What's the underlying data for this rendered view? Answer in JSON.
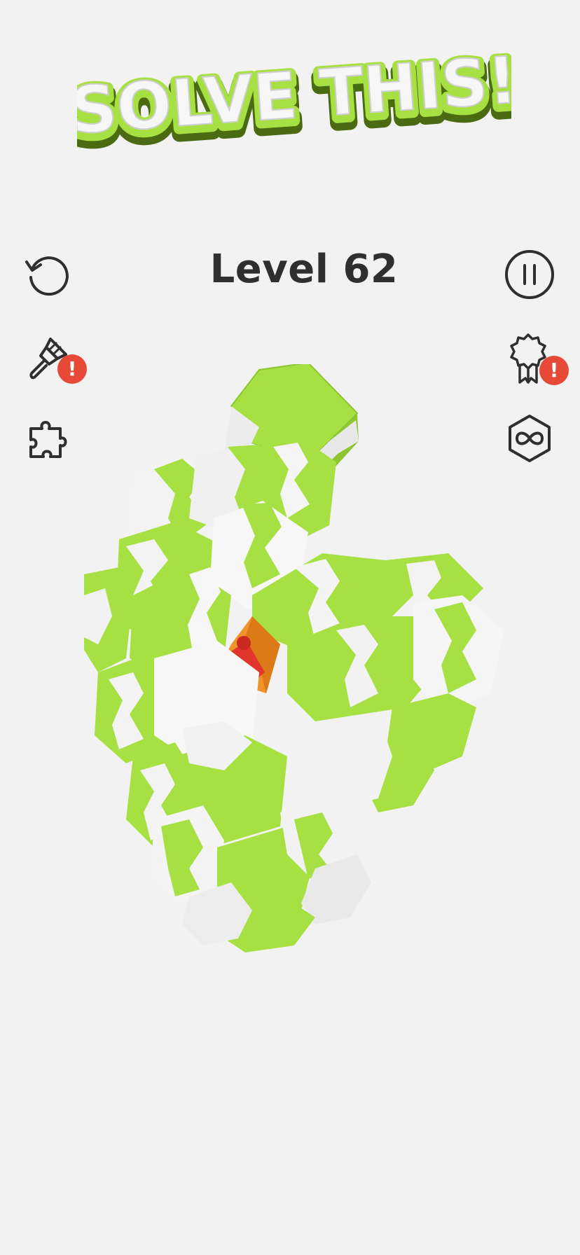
{
  "banner": {
    "text": "SOLVE THIS!"
  },
  "header": {
    "level_label": "Level 62"
  },
  "left_toolbar": {
    "restart": "restart-icon",
    "paint": "paint-brush-icon",
    "paint_badge": "!",
    "puzzle": "puzzle-piece-icon"
  },
  "right_toolbar": {
    "pause": "pause-icon",
    "achievement": "award-ribbon-icon",
    "achievement_badge": "!",
    "infinite": "infinity-hexagon-icon"
  },
  "colors": {
    "background": "#f2f2f2",
    "cube_green": "#a6e043",
    "cube_white": "#f4f4f4",
    "badge_red": "#e64a37",
    "icon_dark": "#2f2f2f",
    "gift_orange": "#f0932b",
    "gift_ribbon": "#e0362c"
  }
}
